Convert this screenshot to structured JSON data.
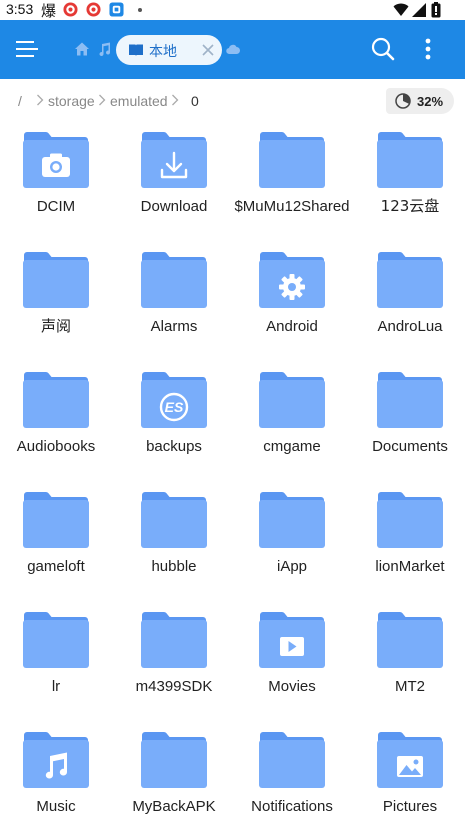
{
  "status_bar": {
    "time": "3:53",
    "extra_char": "爆",
    "notification_icons": [
      "red-app-icon",
      "red-app-icon",
      "blue-app-icon"
    ],
    "battery_icon": "battery-icon",
    "wifi_icon": "wifi-icon",
    "signal_icon": "signal-icon"
  },
  "toolbar": {
    "background": "#1e88e5",
    "tab_label": "本地",
    "icons": [
      "menu-icon",
      "home-icon",
      "music-icon",
      "cloud-icon",
      "search-icon",
      "more-icon"
    ]
  },
  "breadcrumb": {
    "items": [
      "/",
      "storage",
      "emulated",
      "0"
    ],
    "storage_percent": "32%",
    "storage_used_fraction": 0.32
  },
  "folders": [
    {
      "name": "DCIM",
      "overlay": "camera-icon"
    },
    {
      "name": "Download",
      "overlay": "download-icon"
    },
    {
      "name": "$MuMu12Shared",
      "overlay": ""
    },
    {
      "name": "123云盘",
      "overlay": ""
    },
    {
      "name": "声阅",
      "overlay": ""
    },
    {
      "name": "Alarms",
      "overlay": ""
    },
    {
      "name": "Android",
      "overlay": "gear-icon"
    },
    {
      "name": "AndroLua",
      "overlay": ""
    },
    {
      "name": "Audiobooks",
      "overlay": ""
    },
    {
      "name": "backups",
      "overlay": "es-logo-icon"
    },
    {
      "name": "cmgame",
      "overlay": ""
    },
    {
      "name": "Documents",
      "overlay": ""
    },
    {
      "name": "gameloft",
      "overlay": ""
    },
    {
      "name": "hubble",
      "overlay": ""
    },
    {
      "name": "iApp",
      "overlay": ""
    },
    {
      "name": "lionMarket",
      "overlay": ""
    },
    {
      "name": "lr",
      "overlay": ""
    },
    {
      "name": "m4399SDK",
      "overlay": ""
    },
    {
      "name": "Movies",
      "overlay": "play-icon"
    },
    {
      "name": "MT2",
      "overlay": ""
    },
    {
      "name": "Music",
      "overlay": "music-note-icon"
    },
    {
      "name": "MyBackAPK",
      "overlay": ""
    },
    {
      "name": "Notifications",
      "overlay": ""
    },
    {
      "name": "Pictures",
      "overlay": "image-icon"
    }
  ],
  "colors": {
    "folder_front": "#79adfa",
    "folder_back": "#5b97f2",
    "accent": "#1e88e5"
  }
}
